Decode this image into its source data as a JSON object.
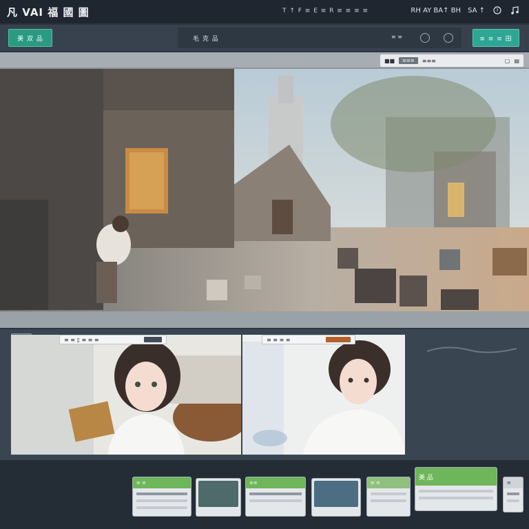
{
  "app": {
    "title": "凡 VAI 福 國 圖"
  },
  "topbar": {
    "center_text": "T ↑ F ≡ E ≡ R ≡ ≡ ≡ ≡",
    "right_text": "RH AY BA↑ BH",
    "user_text": "SA ↑",
    "icons": [
      "settings-icon",
      "help-icon",
      "music-icon"
    ]
  },
  "toolbar": {
    "left_button": "美 双 品",
    "center_label": "毛 克 品",
    "center_hint": "≡ ≡",
    "right_button": "≡ ≡ ≡ 田"
  },
  "main_view": {
    "tools": {
      "chip": "≡≡≡",
      "labels": [
        "■■",
        "≡≡≡"
      ]
    }
  },
  "lower": {
    "panel_left_bar": "≡ ≡ ▯ ≡ ≡ ≡",
    "panel_right_bar": "≡ ≡ ≡ ≡"
  },
  "thumbnails": [
    {
      "label": "≡ ≡"
    },
    {
      "label": ""
    },
    {
      "label": "≡≡"
    },
    {
      "label": ""
    },
    {
      "label": "≡ ≡"
    },
    {
      "label": "美 品"
    },
    {
      "label": "≡"
    }
  ],
  "colors": {
    "accent_green": "#2b9a82",
    "accent_teal": "#2fa594",
    "thumb_green": "#6fb55a"
  }
}
